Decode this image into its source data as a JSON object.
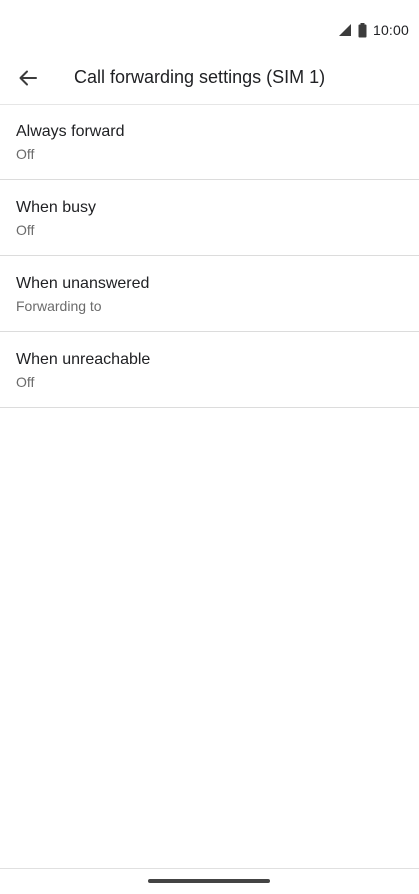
{
  "status_bar": {
    "time": "10:00",
    "icons": [
      "signal-icon",
      "battery-icon"
    ]
  },
  "app_bar": {
    "back_icon": "arrow-back-icon",
    "title": "Call forwarding settings (SIM 1)"
  },
  "items": [
    {
      "title": "Always forward",
      "summary": "Off"
    },
    {
      "title": "When busy",
      "summary": "Off"
    },
    {
      "title": "When unanswered",
      "summary": "Forwarding to"
    },
    {
      "title": "When unreachable",
      "summary": "Off"
    }
  ],
  "colors": {
    "text_primary": "#202124",
    "text_secondary": "#6b6b6b",
    "divider": "#dcdcdc",
    "background": "#ffffff"
  }
}
